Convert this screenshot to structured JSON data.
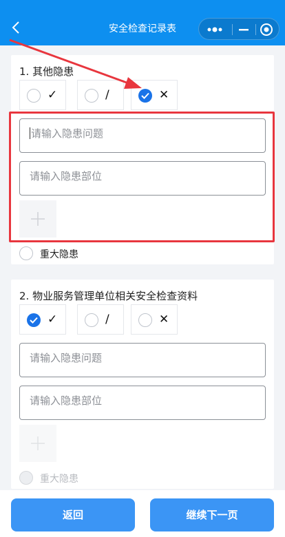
{
  "nav": {
    "title": "安全检查记录表",
    "back_icon": "chevron-left-icon",
    "menu_icon": "more-dots-icon",
    "minimize_icon": "minimize-icon",
    "close_icon": "target-circle-icon",
    "background_color": "#0d8ff0"
  },
  "questions": [
    {
      "title": "1. 其他隐患",
      "options": [
        {
          "mark": "✓",
          "checked": false
        },
        {
          "mark": "/",
          "checked": false
        },
        {
          "mark": "✕",
          "checked": true
        }
      ],
      "issue_placeholder": "请输入隐患问题",
      "location_placeholder": "请输入隐患部位",
      "major_label": "重大隐患",
      "major_disabled": false
    },
    {
      "title": "2. 物业服务管理单位相关安全检查资料",
      "options": [
        {
          "mark": "✓",
          "checked": true
        },
        {
          "mark": "/",
          "checked": false
        },
        {
          "mark": "✕",
          "checked": false
        }
      ],
      "issue_placeholder": "请输入隐患问题",
      "location_placeholder": "请输入隐患部位",
      "major_label": "重大隐患",
      "major_disabled": true
    }
  ],
  "footer": {
    "back_label": "返回",
    "next_label": "继续下一页"
  },
  "annotation": {
    "highlight_color": "#e8363e"
  },
  "colors": {
    "accent": "#1a73e8",
    "button": "#3b95f5"
  }
}
